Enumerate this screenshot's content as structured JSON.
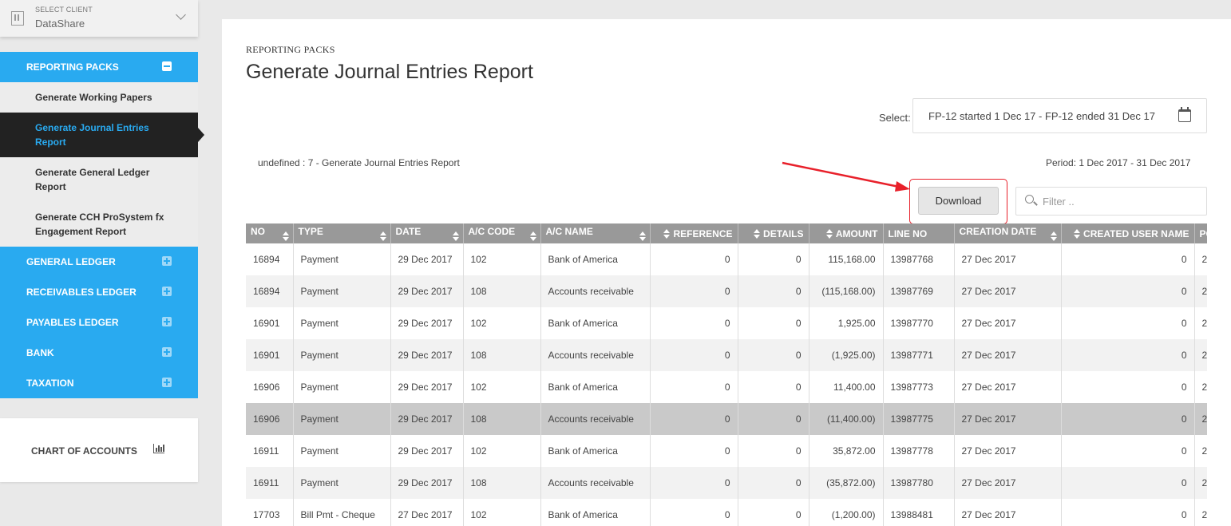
{
  "client": {
    "caption": "SELECT CLIENT",
    "value": "DataShare"
  },
  "nav": {
    "reporting_packs": "REPORTING PACKS",
    "items": [
      "Generate Working Papers",
      "Generate Journal Entries Report",
      "Generate General Ledger Report",
      "Generate CCH ProSystem fx Engagement Report"
    ],
    "sections": [
      "GENERAL LEDGER",
      "RECEIVABLES LEDGER",
      "PAYABLES LEDGER",
      "BANK",
      "TAXATION"
    ],
    "chart_of_accounts": "CHART OF ACCOUNTS"
  },
  "page": {
    "breadcrumb": "REPORTING PACKS",
    "title": "Generate Journal Entries Report",
    "select_label": "Select:",
    "period_value": "FP-12 started 1 Dec 17 - FP-12 ended 31 Dec 17",
    "subtitle": "undefined : 7 - Generate Journal Entries Report",
    "period_text": "Period: 1 Dec 2017 - 31 Dec 2017",
    "download_label": "Download",
    "filter_placeholder": "Filter .."
  },
  "table": {
    "headers": [
      "NO",
      "TYPE",
      "DATE",
      "A/C CODE",
      "A/C NAME",
      "REFERENCE",
      "DETAILS",
      "AMOUNT",
      "LINE NO",
      "CREATION DATE",
      "CREATED USER NAME",
      "PO"
    ],
    "rows": [
      [
        "16894",
        "Payment",
        "29 Dec 2017",
        "102",
        "Bank of America",
        "0",
        "0",
        "115,168.00",
        "13987768",
        "27 Dec 2017",
        "0",
        "2"
      ],
      [
        "16894",
        "Payment",
        "29 Dec 2017",
        "108",
        "Accounts receivable",
        "0",
        "0",
        "(115,168.00)",
        "13987769",
        "27 Dec 2017",
        "0",
        "2"
      ],
      [
        "16901",
        "Payment",
        "29 Dec 2017",
        "102",
        "Bank of America",
        "0",
        "0",
        "1,925.00",
        "13987770",
        "27 Dec 2017",
        "0",
        "2"
      ],
      [
        "16901",
        "Payment",
        "29 Dec 2017",
        "108",
        "Accounts receivable",
        "0",
        "0",
        "(1,925.00)",
        "13987771",
        "27 Dec 2017",
        "0",
        "2"
      ],
      [
        "16906",
        "Payment",
        "29 Dec 2017",
        "102",
        "Bank of America",
        "0",
        "0",
        "11,400.00",
        "13987773",
        "27 Dec 2017",
        "0",
        "2"
      ],
      [
        "16906",
        "Payment",
        "29 Dec 2017",
        "108",
        "Accounts receivable",
        "0",
        "0",
        "(11,400.00)",
        "13987775",
        "27 Dec 2017",
        "0",
        "2"
      ],
      [
        "16911",
        "Payment",
        "29 Dec 2017",
        "102",
        "Bank of America",
        "0",
        "0",
        "35,872.00",
        "13987778",
        "27 Dec 2017",
        "0",
        "2"
      ],
      [
        "16911",
        "Payment",
        "29 Dec 2017",
        "108",
        "Accounts receivable",
        "0",
        "0",
        "(35,872.00)",
        "13987780",
        "27 Dec 2017",
        "0",
        "2"
      ],
      [
        "17703",
        "Bill Pmt - Cheque",
        "27 Dec 2017",
        "102",
        "Bank of America",
        "0",
        "0",
        "(1,200.00)",
        "13988481",
        "27 Dec 2017",
        "0",
        "2"
      ]
    ]
  },
  "colors": {
    "accent": "#29aaf0",
    "header": "#999999",
    "highlight": "#e8202a"
  }
}
